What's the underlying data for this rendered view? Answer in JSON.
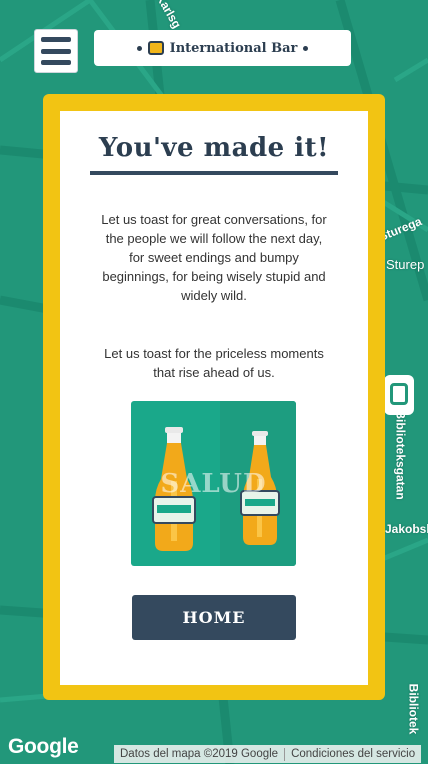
{
  "header": {
    "title": "International Bar"
  },
  "map": {
    "street_labels": [
      "Karlsg",
      "Sturega",
      "Sturep",
      "Biblioteksgatan",
      "Jakobsb",
      "Bibliotek"
    ],
    "google_logo": "Google",
    "attribution": "Datos del mapa ©2019 Google",
    "terms": "Condiciones del servicio"
  },
  "card": {
    "headline": "You've made it!",
    "paragraph1": "Let us toast for great conversations, for the people we will follow the next day, for sweet endings and bumpy beginnings, for being wisely stupid and widely wild.",
    "paragraph2": "Let us toast for the priceless moments that rise ahead of us.",
    "image_text": "SALUD",
    "home_label": "HOME"
  },
  "colors": {
    "map_green": "#22977a",
    "card_yellow": "#f2c413",
    "navy": "#34495e"
  }
}
